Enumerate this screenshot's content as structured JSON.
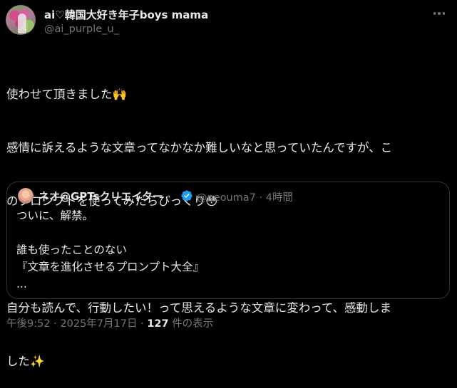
{
  "author": {
    "display_name": "ai♡韓国大好き年子boys mama",
    "handle": "@ai_purple_u_"
  },
  "tweet": {
    "lines": [
      "使わせて頂きました🙌",
      "感情に訴えるような文章ってなかなか難しいなと思っていたんですが、こ",
      "のプロンプトを使ってみたらびっくり😳",
      "",
      "自分も読んで、行動したい！って思えるような文章に変わって、感動しま",
      "した✨"
    ]
  },
  "quoted": {
    "display_name": "ネオ@GPTsクリエイター",
    "handle": "@neouma7",
    "separator": "·",
    "time": "4時間",
    "lines": [
      "ついに、解禁。",
      "",
      "誰も使ったことのない",
      "『文章を進化させるプロンプト大全』",
      "..."
    ]
  },
  "meta": {
    "time": "午後9:52",
    "sep1": "·",
    "date": "2025年7月17日",
    "sep2": "·",
    "views_count": "127",
    "views_label": "件の表示"
  },
  "colors": {
    "background": "#000000",
    "text": "#e7e9ea",
    "secondary": "#71767b",
    "verified": "#1d9bf0"
  },
  "icons": {
    "more": "more-horizontal-icon",
    "verified": "verified-badge-icon"
  }
}
